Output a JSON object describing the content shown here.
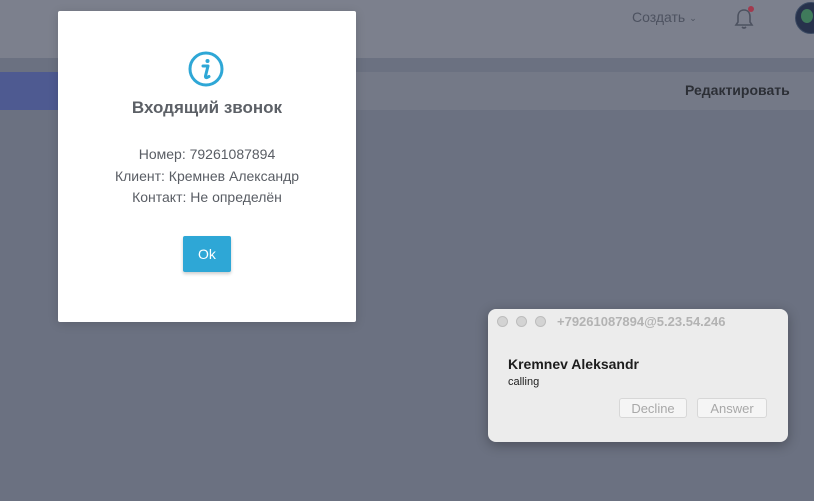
{
  "header": {
    "create_label": "Создать",
    "edit_label": "Редактировать"
  },
  "modal": {
    "icon": "info-circle-icon",
    "title": "Входящий звонок",
    "number_line": "Номер: 79261087894",
    "client_line": "Клиент: Кремнев Александр",
    "contact_line": "Контакт: Не определён",
    "ok_label": "Ok",
    "accent_color": "#2ea7d6"
  },
  "notification": {
    "title": "+79261087894@5.23.54.246",
    "caller": "Kremnev Aleksandr",
    "status": "calling",
    "decline_label": "Decline",
    "answer_label": "Answer"
  }
}
